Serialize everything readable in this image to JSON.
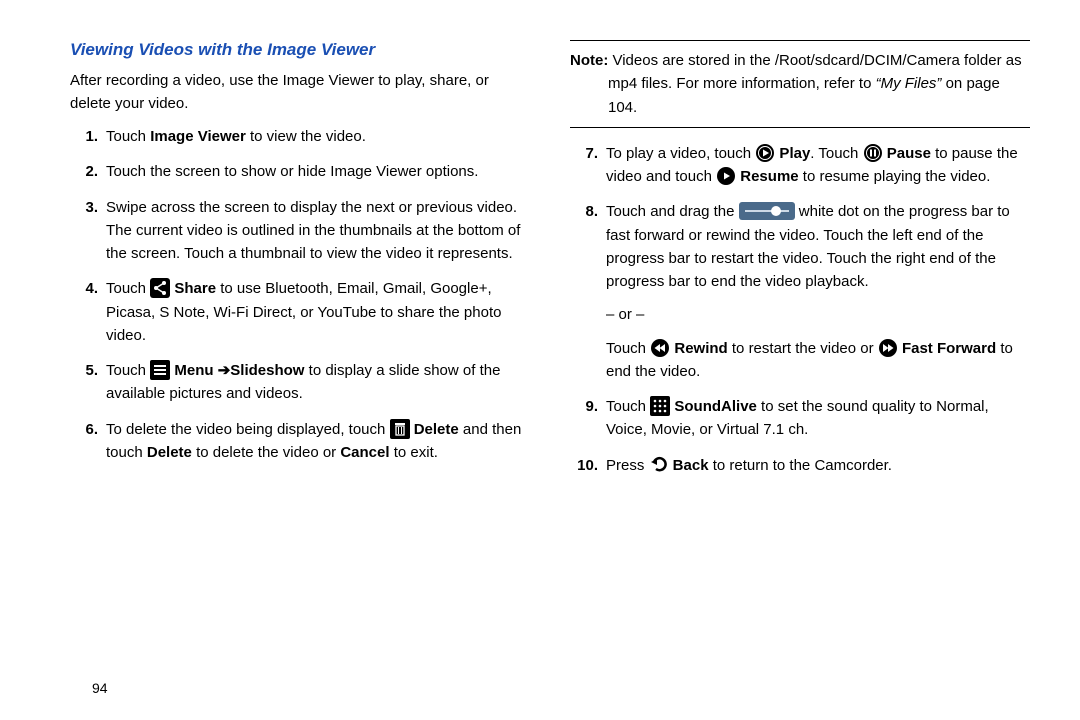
{
  "heading": "Viewing Videos with the Image Viewer",
  "intro": "After recording a video, use the Image Viewer to play, share, or delete your video.",
  "pagenum": "94",
  "left": {
    "s1a": "Touch ",
    "s1b": "Image Viewer",
    "s1c": " to view the video.",
    "s2": "Touch the screen to show or hide Image Viewer options.",
    "s3": "Swipe across the screen to display the next or previous video. The current video is outlined in the thumbnails at the bottom of the screen. Touch a thumbnail to view the video it represents.",
    "s4a": "Touch ",
    "s4b": " Share",
    "s4c": " to use Bluetooth, Email, Gmail, Google+, Picasa, S Note, Wi-Fi Direct, or YouTube to share the photo video.",
    "s5a": "Touch ",
    "s5b": " Menu",
    "s5c": "Slideshow",
    "s5d": " to display a slide show of the available pictures and videos.",
    "s6a": "To delete the video being displayed, touch ",
    "s6b": " Delete",
    "s6c": " and then touch ",
    "s6d": "Delete",
    "s6e": " to delete the video or ",
    "s6f": "Cancel",
    "s6g": " to exit."
  },
  "note": {
    "label": "Note:",
    "a": " Videos are stored in the /Root/sdcard/DCIM/Camera folder as mp4 files. For more information, refer to ",
    "b": "“My Files”",
    "c": "  on page 104."
  },
  "right": {
    "s7a": "To play a video, touch ",
    "s7b": " Play",
    "s7c": ". Touch ",
    "s7d": " Pause",
    "s7e": " to pause the video and touch ",
    "s7f": " Resume",
    "s7g": " to resume playing the video.",
    "s8a": "Touch and drag the ",
    "s8b": " white dot on the progress bar to fast forward or rewind the video. Touch the left end of the progress bar to restart the video. Touch the right end of the progress bar to end the video playback.",
    "or": "– or –",
    "s8c": "Touch ",
    "s8d": " Rewind",
    "s8e": " to restart the video or ",
    "s8f": " Fast Forward",
    "s8g": " to end the video.",
    "s9a": "Touch ",
    "s9b": " SoundAlive",
    "s9c": " to set the sound quality to Normal, Voice, Movie, or Virtual 7.1 ch.",
    "s10a": "Press ",
    "s10b": " Back",
    "s10c": " to return to the Camcorder."
  }
}
